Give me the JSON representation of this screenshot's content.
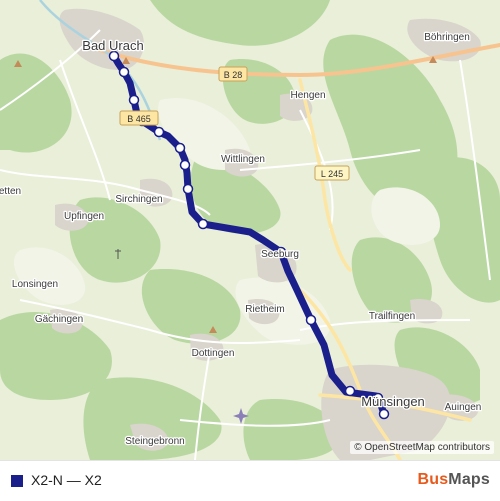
{
  "map": {
    "route_color": "#1a1f8c",
    "places": {
      "bad_urach": "Bad Urach",
      "bohringen": "Böhringen",
      "hengen": "Hengen",
      "wittlingen": "Wittlingen",
      "sirchingen": "Sirchingen",
      "upfingen": "Upfingen",
      "etten": "etten",
      "lonsingen": "Lonsingen",
      "gachingen": "Gächingen",
      "seeburg": "Seeburg",
      "rietheim": "Rietheim",
      "trailfingen": "Trailfingen",
      "dottingen": "Dottingen",
      "munsingen": "Münsingen",
      "auingen": "Auingen",
      "steingebronn": "Steingebronn"
    },
    "road_labels": {
      "b28": "B 28",
      "b465": "B 465",
      "l245": "L 245"
    },
    "attribution": "© OpenStreetMap contributors"
  },
  "legend": {
    "route_label": "X2-N — X2",
    "swatch_color": "#1a1f8c"
  },
  "brand": {
    "part1": "Bus",
    "part2": "Maps"
  }
}
